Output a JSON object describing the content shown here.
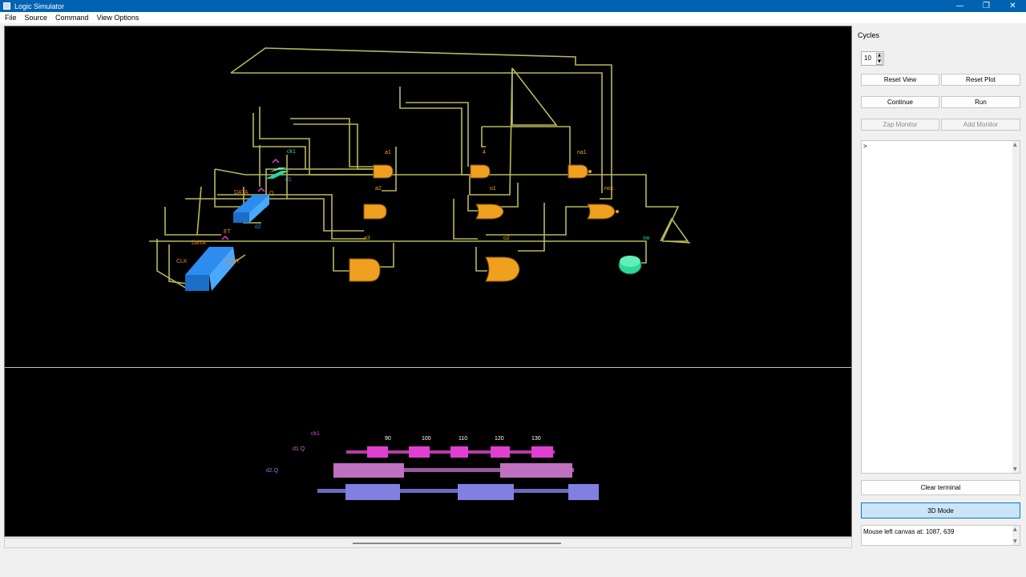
{
  "window": {
    "title": "Logic Simulator",
    "minimize": "—",
    "restore": "❐",
    "close": "✕"
  },
  "menu": [
    "File",
    "Source",
    "Command",
    "View Options"
  ],
  "sidebar": {
    "cycles_label": "Cycles",
    "cycles_value": "10",
    "reset_view": "Reset View",
    "reset_plot": "Reset Plot",
    "continue": "Continue",
    "run": "Run",
    "zap_monitor": "Zap Monitor",
    "add_monitor": "Add Monitor",
    "terminal_text": ">",
    "clear_terminal": "Clear terminal",
    "mode_3d": "3D Mode",
    "status_text": "Mouse left canvas at: 1087, 639"
  },
  "circuit": {
    "labels": {
      "ck1": "ck1",
      "d1": "d1",
      "d1q": "Q",
      "d2": "d2",
      "data1": "DATA",
      "data2": "DATA",
      "set": "ET",
      "clk": "CLK",
      "clear": "LEAR",
      "a1": "a1",
      "a2": "a2",
      "a3": "a3",
      "a4": "4",
      "o1": "o1",
      "o2": "o2",
      "na1": "na1",
      "no1": "no1",
      "sw": "sw"
    }
  },
  "plot": {
    "signals": [
      "ck1",
      "d1.Q",
      "d2.Q"
    ],
    "ticks": [
      "90",
      "100",
      "110",
      "120",
      "130"
    ]
  },
  "colors": {
    "wire": "#b8b85a",
    "gate": "#f0a020",
    "dtype": "#2d8cf0",
    "clock": "#27d4a0",
    "switch": "#2ed89a",
    "ck_trace": "#e040d0",
    "d1_trace": "#c070c0",
    "d2_trace": "#8080e0"
  }
}
